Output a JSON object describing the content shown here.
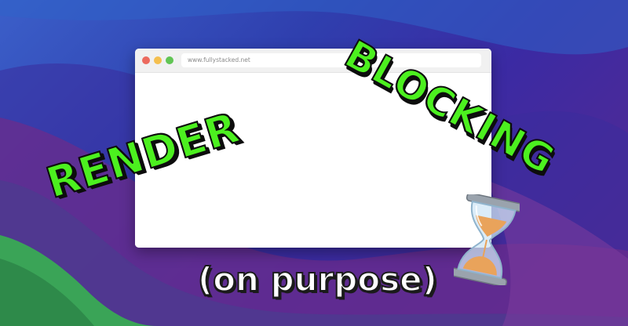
{
  "browser": {
    "url": "www.fullystacked.net"
  },
  "headline": {
    "word1": "RENDER",
    "word2": "BLOCKING"
  },
  "subtitle": "(on purpose)",
  "icons": {
    "window_controls": [
      "close-dot-icon",
      "minimize-dot-icon",
      "maximize-dot-icon"
    ],
    "emoji": "hourglass-icon"
  },
  "colors": {
    "slime_green": "#4cf01f",
    "outline": "#0d0d0d",
    "close": "#ec6a5e",
    "minimize": "#f4bf4f",
    "maximize": "#61c554",
    "sand": "#e9a35b"
  }
}
